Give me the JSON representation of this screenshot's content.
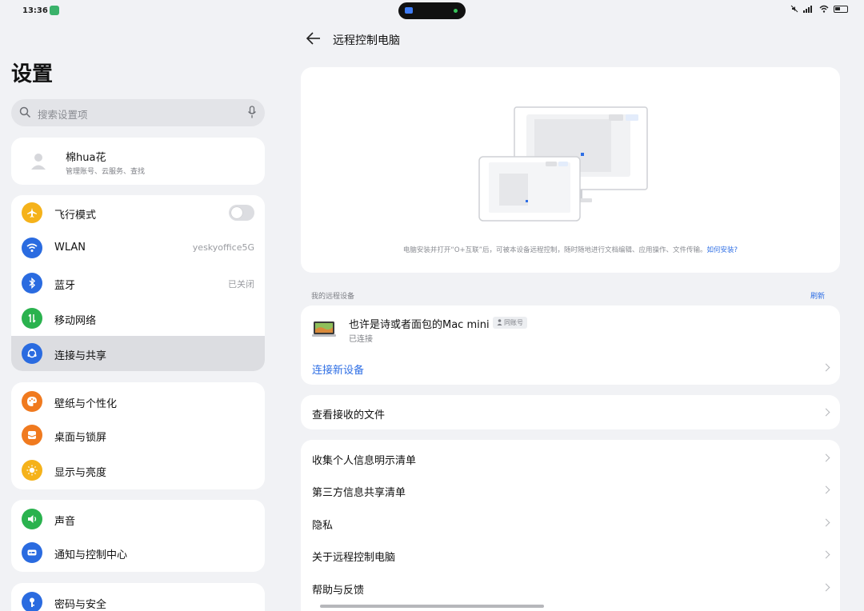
{
  "status_bar": {
    "time": "13:36"
  },
  "sidebar": {
    "title": "设置",
    "search_placeholder": "搜索设置项",
    "account": {
      "name": "棉hua花",
      "subtitle": "管理账号、云服务、查找"
    },
    "groups": [
      [
        {
          "label": "飞行模式",
          "icon": "airplane-icon",
          "color": "#f5b21a",
          "control": "toggle",
          "value": ""
        },
        {
          "label": "WLAN",
          "icon": "wifi-icon",
          "color": "#2a6be0",
          "value": "yeskyoffice5G"
        },
        {
          "label": "蓝牙",
          "icon": "bluetooth-icon",
          "color": "#2a6be0",
          "value": "已关闭"
        },
        {
          "label": "移动网络",
          "icon": "mobile-data-icon",
          "color": "#2ab24e",
          "value": ""
        },
        {
          "label": "连接与共享",
          "icon": "share-icon",
          "color": "#2a6be0",
          "value": "",
          "selected": true
        }
      ],
      [
        {
          "label": "壁纸与个性化",
          "icon": "palette-icon",
          "color": "#f07a1f",
          "value": ""
        },
        {
          "label": "桌面与锁屏",
          "icon": "desktop-icon",
          "color": "#f07a1f",
          "value": ""
        },
        {
          "label": "显示与亮度",
          "icon": "brightness-icon",
          "color": "#f5b21a",
          "value": ""
        }
      ],
      [
        {
          "label": "声音",
          "icon": "sound-icon",
          "color": "#2ab24e",
          "value": ""
        },
        {
          "label": "通知与控制中心",
          "icon": "notification-icon",
          "color": "#2a6be0",
          "value": ""
        }
      ],
      [
        {
          "label": "密码与安全",
          "icon": "key-icon",
          "color": "#2a6be0",
          "value": ""
        }
      ]
    ]
  },
  "main": {
    "title": "远程控制电脑",
    "hero": {
      "description": "电脑安装并打开“O+互联”后，可被本设备远程控制，随时随地进行文档编辑、应用操作、文件传输。",
      "link": "如何安装?"
    },
    "my_devices_label": "我的远程设备",
    "refresh_label": "刷新",
    "device": {
      "name": "也许是诗或者面包的Mac mini",
      "badge": "同账号",
      "status": "已连接"
    },
    "connect_new_label": "连接新设备",
    "view_files_label": "查看接收的文件",
    "list_items": [
      "收集个人信息明示清单",
      "第三方信息共享清单",
      "隐私",
      "关于远程控制电脑",
      "帮助与反馈"
    ]
  }
}
